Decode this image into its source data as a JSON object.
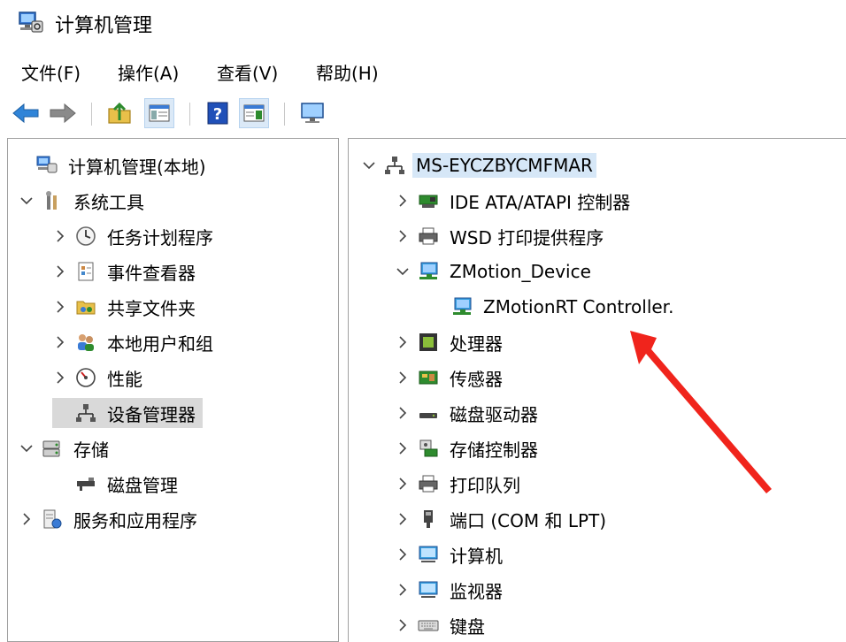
{
  "window": {
    "title": "计算机管理",
    "icon": "computer-management-icon"
  },
  "menu": [
    "文件(F)",
    "操作(A)",
    "查看(V)",
    "帮助(H)"
  ],
  "toolbar": [
    "back-arrow-icon",
    "forward-arrow-icon",
    "up-folder-icon",
    "show-hide-tree-icon",
    "help-icon",
    "properties-icon",
    "monitor-icon"
  ],
  "left_tree": [
    {
      "label": "计算机管理(本地)",
      "icon": "computer-management-icon",
      "expand": "none"
    },
    {
      "label": "系统工具",
      "icon": "tools-icon",
      "expand": "expanded"
    },
    {
      "label": "任务计划程序",
      "icon": "clock-icon",
      "expand": "collapsed"
    },
    {
      "label": "事件查看器",
      "icon": "event-viewer-icon",
      "expand": "collapsed"
    },
    {
      "label": "共享文件夹",
      "icon": "shared-folder-icon",
      "expand": "collapsed"
    },
    {
      "label": "本地用户和组",
      "icon": "users-icon",
      "expand": "collapsed"
    },
    {
      "label": "性能",
      "icon": "performance-icon",
      "expand": "collapsed"
    },
    {
      "label": "设备管理器",
      "icon": "device-manager-icon",
      "expand": "none",
      "selected": true
    },
    {
      "label": "存储",
      "icon": "storage-icon",
      "expand": "expanded"
    },
    {
      "label": "磁盘管理",
      "icon": "disk-management-icon",
      "expand": "none"
    },
    {
      "label": "服务和应用程序",
      "icon": "services-icon",
      "expand": "collapsed"
    }
  ],
  "right_tree": [
    {
      "label": "MS-EYCZBYCMFMAR",
      "icon": "computer-network-icon",
      "expand": "expanded",
      "highlight": true
    },
    {
      "label": "IDE ATA/ATAPI 控制器",
      "icon": "ide-controller-icon",
      "expand": "collapsed"
    },
    {
      "label": "WSD 打印提供程序",
      "icon": "printer-icon",
      "expand": "collapsed"
    },
    {
      "label": "ZMotion_Device",
      "icon": "monitor-network-icon",
      "expand": "expanded"
    },
    {
      "label": "ZMotionRT Controller.",
      "icon": "monitor-network-icon",
      "expand": "none"
    },
    {
      "label": "处理器",
      "icon": "processor-icon",
      "expand": "collapsed"
    },
    {
      "label": "传感器",
      "icon": "sensor-icon",
      "expand": "collapsed"
    },
    {
      "label": "磁盘驱动器",
      "icon": "disk-drive-icon",
      "expand": "collapsed"
    },
    {
      "label": "存储控制器",
      "icon": "storage-controller-icon",
      "expand": "collapsed"
    },
    {
      "label": "打印队列",
      "icon": "printer-icon",
      "expand": "collapsed"
    },
    {
      "label": "端口 (COM 和 LPT)",
      "icon": "port-icon",
      "expand": "collapsed"
    },
    {
      "label": "计算机",
      "icon": "monitor-icon",
      "expand": "collapsed"
    },
    {
      "label": "监视器",
      "icon": "monitor-icon",
      "expand": "collapsed"
    },
    {
      "label": "键盘",
      "icon": "keyboard-icon",
      "expand": "collapsed"
    }
  ],
  "colors": {
    "annotation": "#f0241c",
    "highlight": "#d6e7f7",
    "selected": "#d9d9d9",
    "pane_border": "#a0a0a0"
  }
}
